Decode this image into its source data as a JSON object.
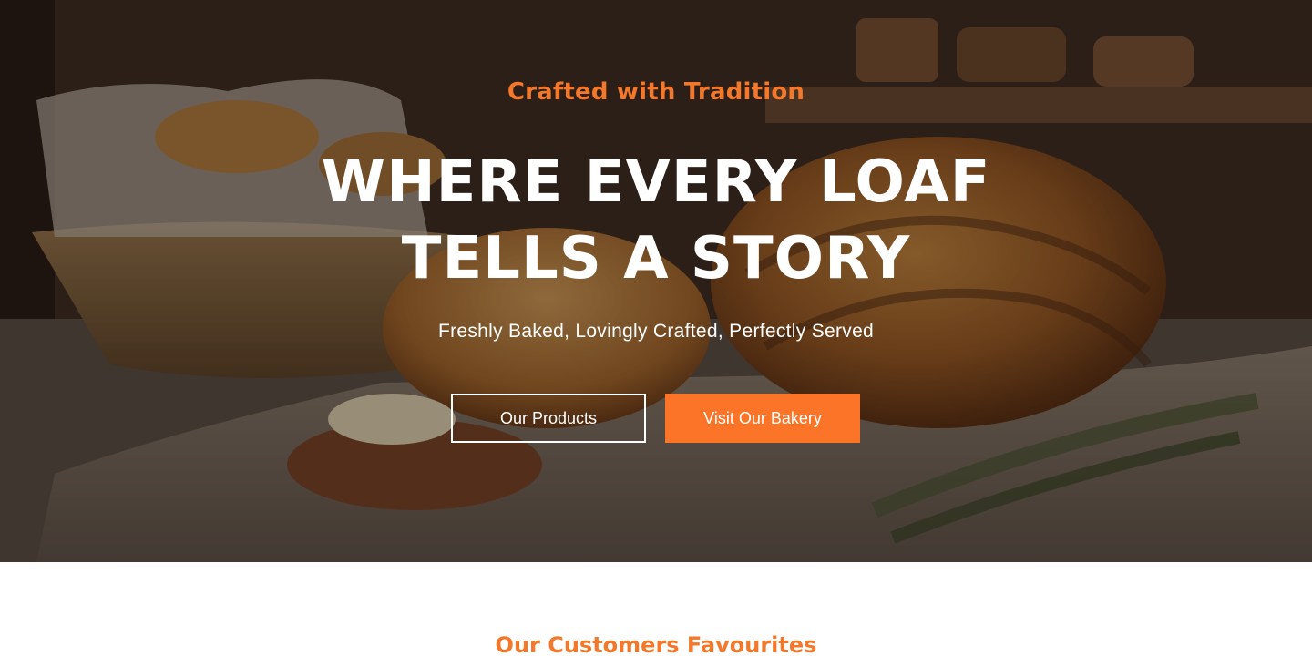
{
  "hero": {
    "eyebrow": "Crafted with Tradition",
    "headline": "WHERE EVERY LOAF TELLS A STORY",
    "subline": "Freshly Baked, Lovingly Crafted, Perfectly Served",
    "buttons": {
      "products_label": "Our Products",
      "visit_label": "Visit Our Bakery"
    },
    "image": "bakery-bread-hero-image"
  },
  "favourites": {
    "title": "Our Customers Favourites"
  },
  "colors": {
    "accent": "#fb7427",
    "eyebrow": "#f4782c",
    "text_on_dark": "#ffffff"
  }
}
